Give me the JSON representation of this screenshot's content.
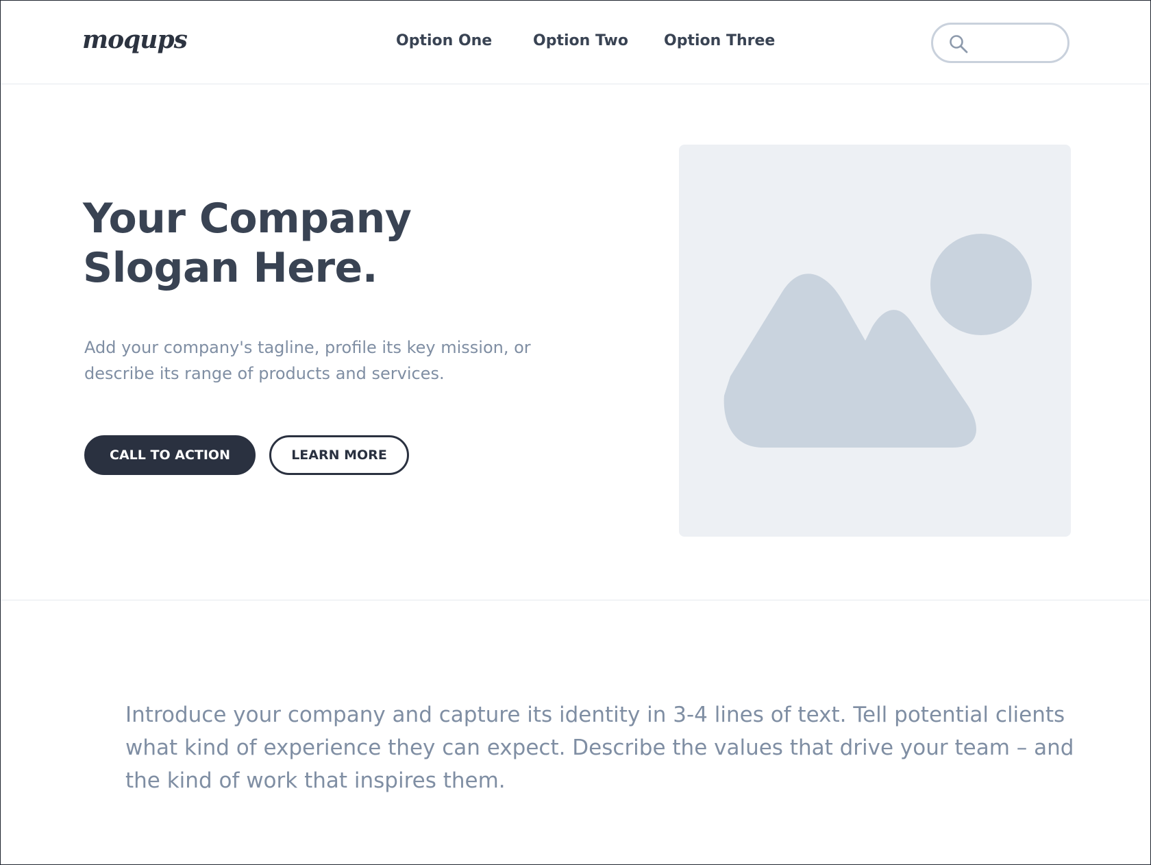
{
  "header": {
    "logo": "moqups",
    "nav": [
      "Option One",
      "Option Two",
      "Option Three"
    ],
    "search": {
      "placeholder": "",
      "value": ""
    }
  },
  "hero": {
    "title_lines": [
      "Your Company",
      "Slogan Here."
    ],
    "tagline_lines": [
      "Add your company's tagline, profile its key mission, or",
      "describe its range of products and services."
    ],
    "primary_button": "CALL TO ACTION",
    "secondary_button": "LEARN MORE",
    "image_icon": "image-placeholder-icon"
  },
  "intro": {
    "lines": [
      "Introduce your company and capture its identity in 3-4 lines of text. Tell potential clients",
      "what kind of experience they can expect. Describe the values that drive your team – and",
      "the kind of work that inspires them."
    ]
  },
  "colors": {
    "text_dark": "#394353",
    "text_muted": "#7f8ea3",
    "button_dark": "#2a3140",
    "placeholder_bg": "#edf0f4",
    "placeholder_shape": "#c9d3de",
    "divider": "#e6e9ee"
  }
}
